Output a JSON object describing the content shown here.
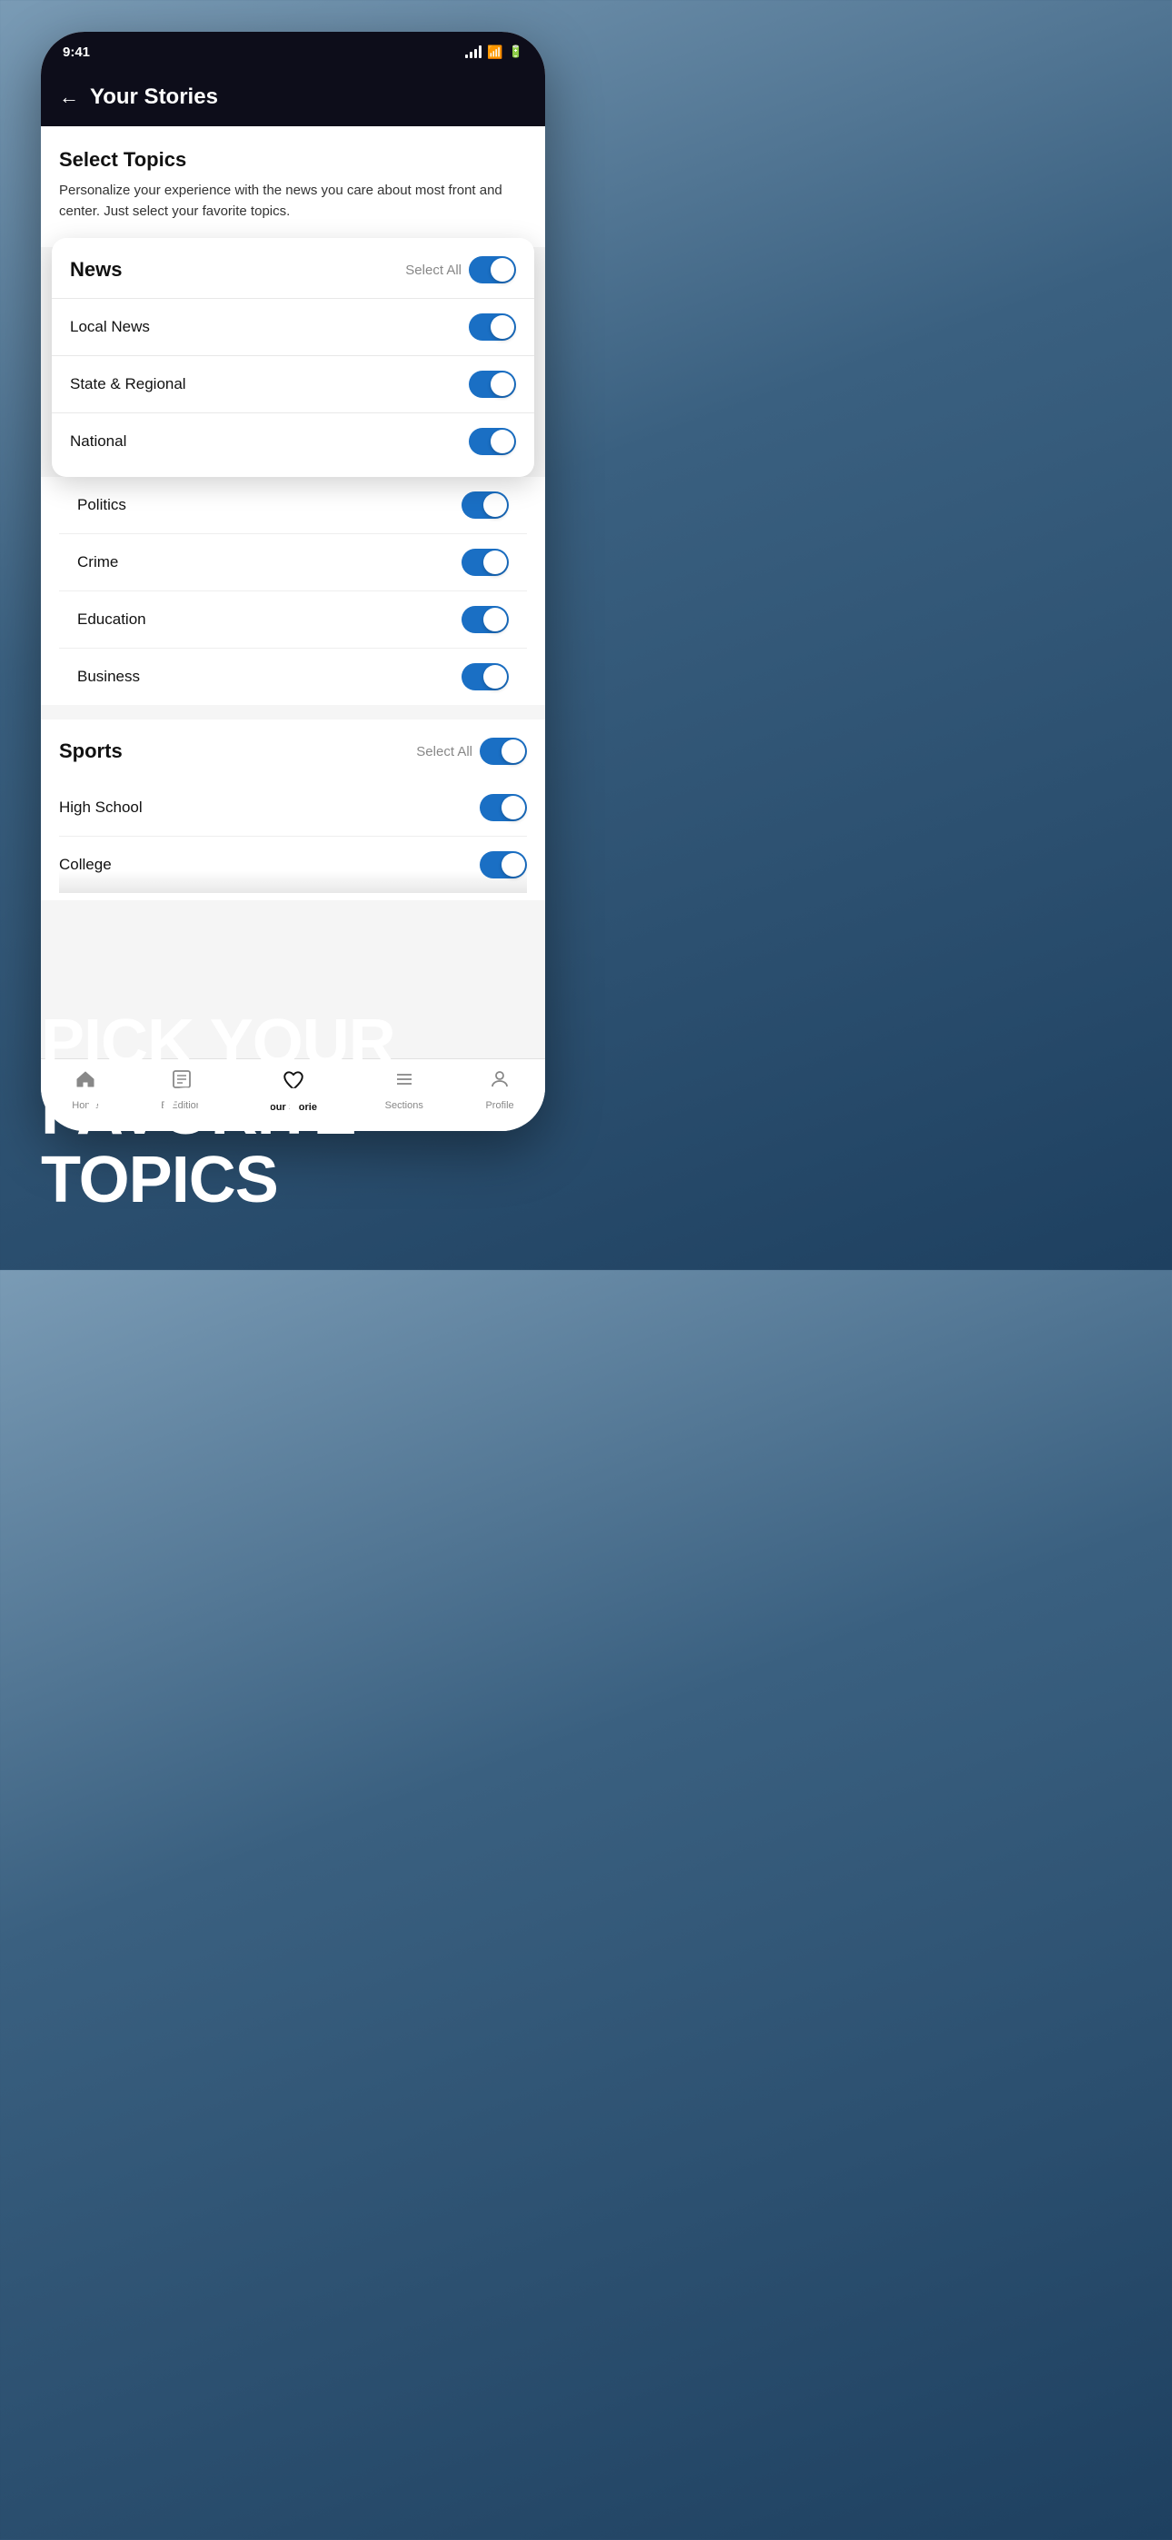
{
  "statusBar": {
    "time": "9:41"
  },
  "header": {
    "title": "Your Stories",
    "backLabel": "←"
  },
  "selectTopics": {
    "title": "Select Topics",
    "description": "Personalize your experience with the news you care about most front and center. Just select your favorite topics."
  },
  "newsSection": {
    "title": "News",
    "selectAllLabel": "Select All",
    "topics": [
      {
        "label": "Local News",
        "enabled": true
      },
      {
        "label": "State & Regional",
        "enabled": true
      },
      {
        "label": "National",
        "enabled": true
      }
    ]
  },
  "moreTopics": [
    {
      "label": "Politics",
      "enabled": true
    },
    {
      "label": "Crime",
      "enabled": true
    },
    {
      "label": "Education",
      "enabled": true
    },
    {
      "label": "Business",
      "enabled": true
    }
  ],
  "sportsSection": {
    "title": "Sports",
    "selectAllLabel": "Select All",
    "topics": [
      {
        "label": "High School",
        "enabled": true
      },
      {
        "label": "College",
        "enabled": true
      }
    ]
  },
  "bottomNav": {
    "items": [
      {
        "label": "Home",
        "icon": "home",
        "active": false
      },
      {
        "label": "E-Edition",
        "icon": "newspaper",
        "active": false
      },
      {
        "label": "Your Stories",
        "icon": "heart",
        "active": true
      },
      {
        "label": "Sections",
        "icon": "list",
        "active": false
      },
      {
        "label": "Profile",
        "icon": "person",
        "active": false
      }
    ]
  },
  "bigText": {
    "line1": "PICK YOUR",
    "line2": "FAVORITE",
    "line3": "TOPICS"
  }
}
